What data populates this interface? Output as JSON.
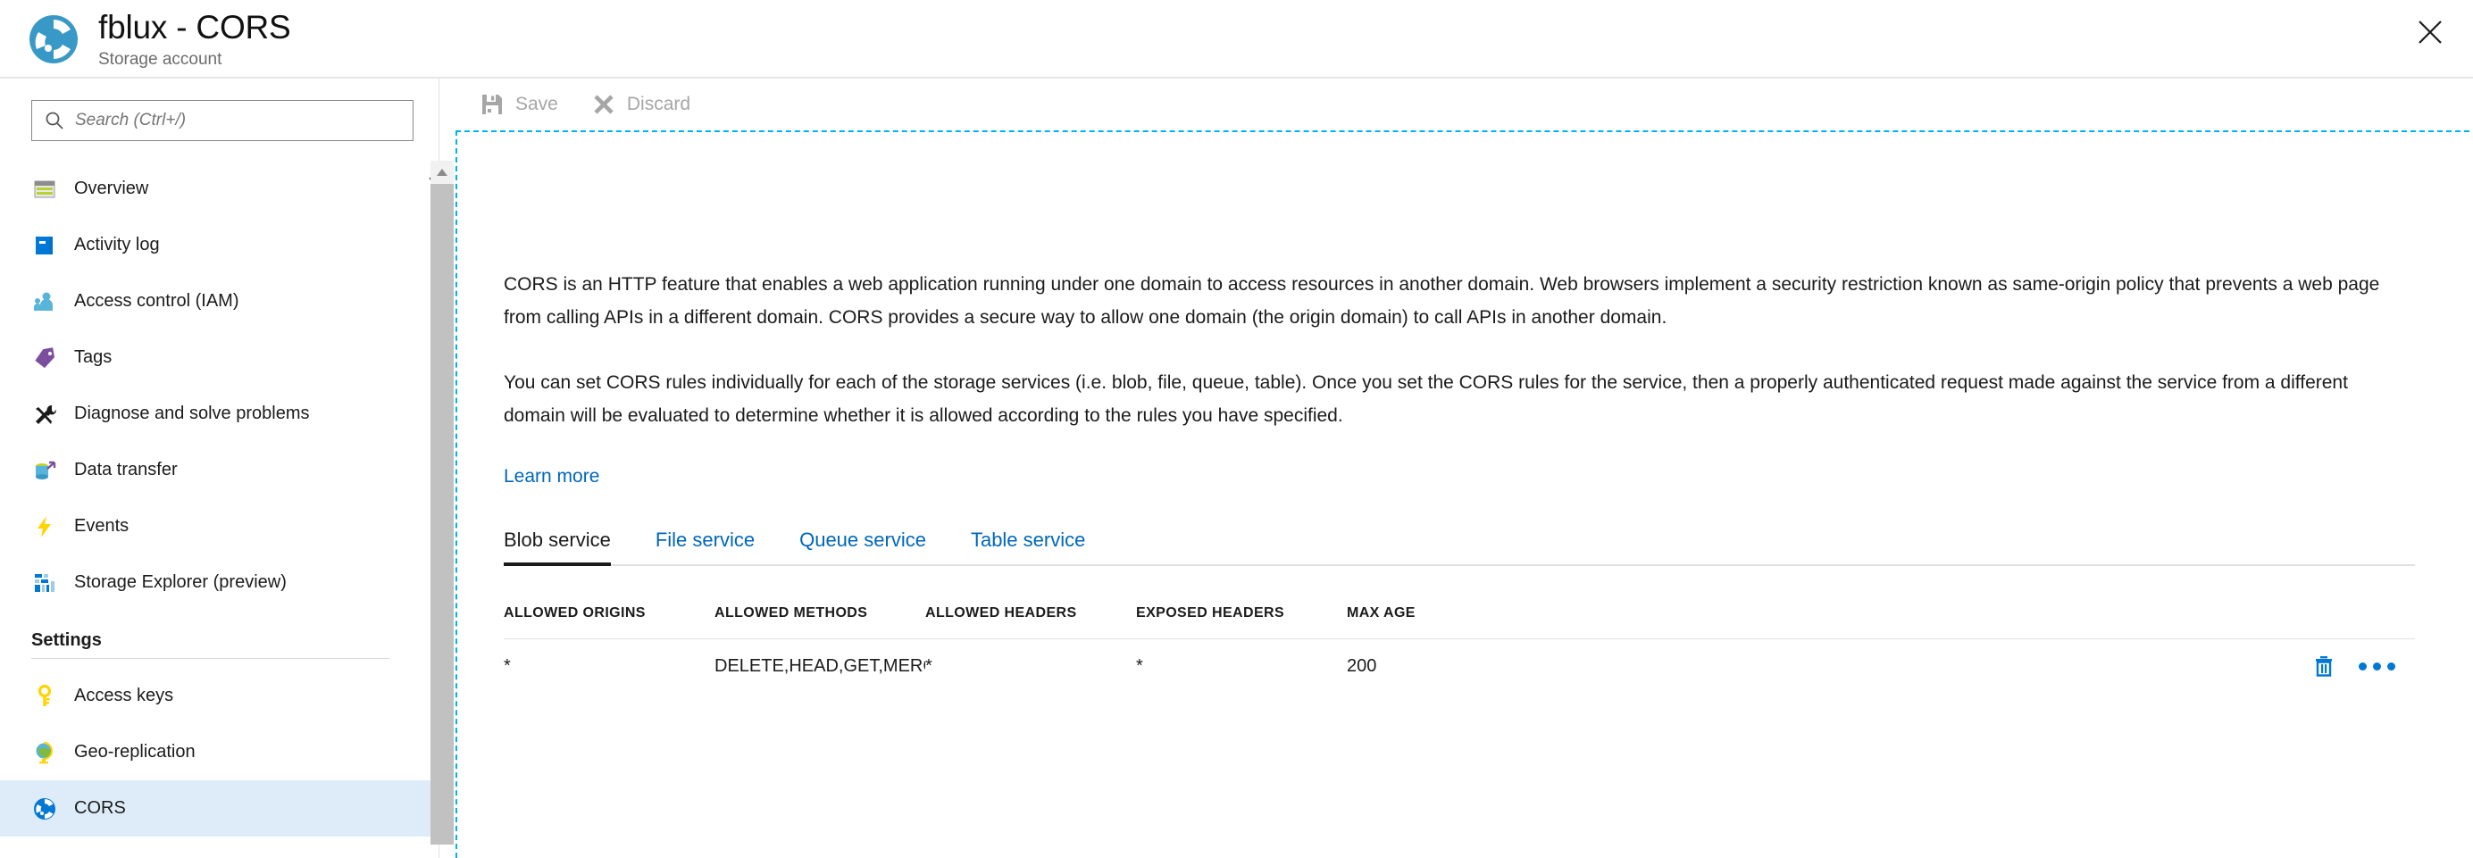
{
  "header": {
    "title": "fblux - CORS",
    "subtitle": "Storage account",
    "icon": "storage-account-icon",
    "close_icon": "close-icon"
  },
  "sidebar": {
    "search": {
      "placeholder": "Search (Ctrl+/)",
      "value": "",
      "icon": "search-icon"
    },
    "collapse_label": "«",
    "items": [
      {
        "label": "Overview",
        "icon": "overview-icon",
        "active": false
      },
      {
        "label": "Activity log",
        "icon": "activity-log-icon",
        "active": false
      },
      {
        "label": "Access control (IAM)",
        "icon": "access-control-icon",
        "active": false
      },
      {
        "label": "Tags",
        "icon": "tags-icon",
        "active": false
      },
      {
        "label": "Diagnose and solve problems",
        "icon": "diagnose-icon",
        "active": false
      },
      {
        "label": "Data transfer",
        "icon": "data-transfer-icon",
        "active": false
      },
      {
        "label": "Events",
        "icon": "events-icon",
        "active": false
      },
      {
        "label": "Storage Explorer (preview)",
        "icon": "storage-explorer-icon",
        "active": false
      }
    ],
    "settings_section": {
      "title": "Settings",
      "items": [
        {
          "label": "Access keys",
          "icon": "key-icon",
          "active": false
        },
        {
          "label": "Geo-replication",
          "icon": "globe-icon",
          "active": false
        },
        {
          "label": "CORS",
          "icon": "cors-icon",
          "active": true
        }
      ]
    }
  },
  "toolbar": {
    "save_label": "Save",
    "save_icon": "save-disk-icon",
    "discard_label": "Discard",
    "discard_icon": "discard-x-icon"
  },
  "main": {
    "paragraph1": "CORS is an HTTP feature that enables a web application running under one domain to access resources in another domain. Web browsers implement a security restriction known as same-origin policy that prevents a web page from calling APIs in a different domain. CORS provides a secure way to allow one domain (the origin domain) to call APIs in another domain.",
    "paragraph2": "You can set CORS rules individually for each of the storage services (i.e. blob, file, queue, table). Once you set the CORS rules for the service, then a properly authenticated request made against the service from a different domain will be evaluated to determine whether it is allowed according to the rules you have specified.",
    "learn_more": "Learn more",
    "tabs": [
      {
        "label": "Blob service",
        "active": true
      },
      {
        "label": "File service",
        "active": false
      },
      {
        "label": "Queue service",
        "active": false
      },
      {
        "label": "Table service",
        "active": false
      }
    ],
    "table": {
      "columns": [
        "ALLOWED ORIGINS",
        "ALLOWED METHODS",
        "ALLOWED HEADERS",
        "EXPOSED HEADERS",
        "MAX AGE"
      ],
      "rows": [
        {
          "allowed_origins": "*",
          "allowed_methods": "DELETE,HEAD,GET,MERGE,PO...",
          "allowed_headers": "*",
          "exposed_headers": "*",
          "max_age": "200",
          "delete_icon": "trash-icon",
          "more_icon": "ellipsis-icon"
        }
      ]
    }
  },
  "colors": {
    "accent": "#0067b8",
    "link": "#0067b8",
    "active_nav_bg": "#deecf9",
    "focus_border": "#00b2f0",
    "icon_blue": "#0078d4",
    "disabled_text": "#a6a6a6"
  }
}
